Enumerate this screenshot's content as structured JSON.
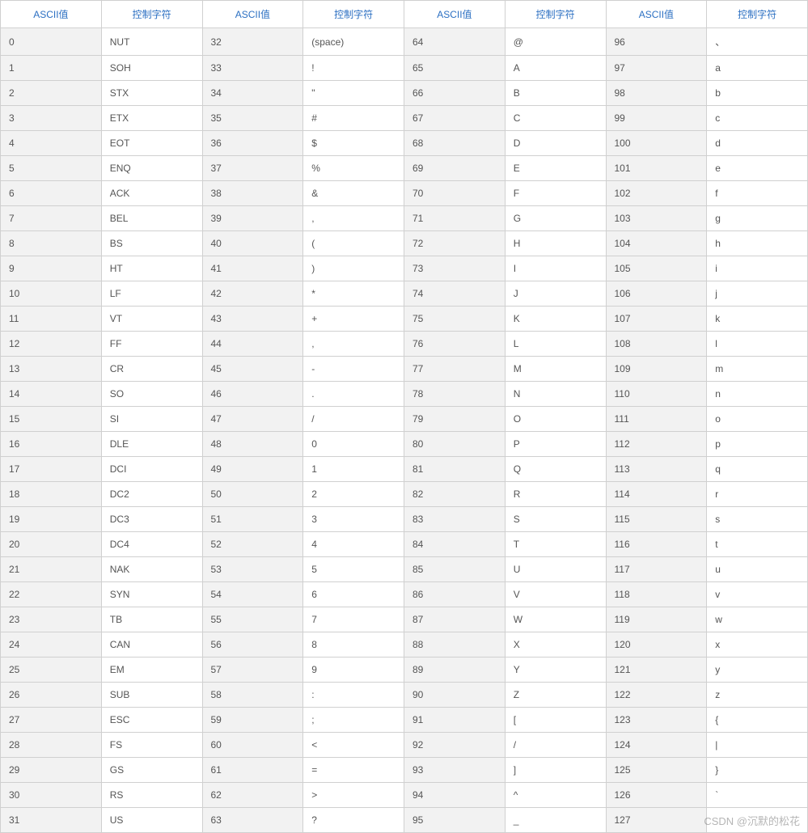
{
  "headers": {
    "ascii": "ASCII值",
    "char": "控制字符"
  },
  "columns": 4,
  "rows": [
    [
      {
        "v": "0",
        "c": "NUT"
      },
      {
        "v": "32",
        "c": "(space)"
      },
      {
        "v": "64",
        "c": "@"
      },
      {
        "v": "96",
        "c": "、"
      }
    ],
    [
      {
        "v": "1",
        "c": "SOH"
      },
      {
        "v": "33",
        "c": "!"
      },
      {
        "v": "65",
        "c": "A"
      },
      {
        "v": "97",
        "c": "a"
      }
    ],
    [
      {
        "v": "2",
        "c": "STX"
      },
      {
        "v": "34",
        "c": "\""
      },
      {
        "v": "66",
        "c": "B"
      },
      {
        "v": "98",
        "c": "b"
      }
    ],
    [
      {
        "v": "3",
        "c": "ETX"
      },
      {
        "v": "35",
        "c": "#"
      },
      {
        "v": "67",
        "c": "C"
      },
      {
        "v": "99",
        "c": "c"
      }
    ],
    [
      {
        "v": "4",
        "c": "EOT"
      },
      {
        "v": "36",
        "c": "$"
      },
      {
        "v": "68",
        "c": "D"
      },
      {
        "v": "100",
        "c": "d"
      }
    ],
    [
      {
        "v": "5",
        "c": "ENQ"
      },
      {
        "v": "37",
        "c": "%"
      },
      {
        "v": "69",
        "c": "E"
      },
      {
        "v": "101",
        "c": "e"
      }
    ],
    [
      {
        "v": "6",
        "c": "ACK"
      },
      {
        "v": "38",
        "c": "&"
      },
      {
        "v": "70",
        "c": "F"
      },
      {
        "v": "102",
        "c": "f"
      }
    ],
    [
      {
        "v": "7",
        "c": "BEL"
      },
      {
        "v": "39",
        "c": ","
      },
      {
        "v": "71",
        "c": "G"
      },
      {
        "v": "103",
        "c": "g"
      }
    ],
    [
      {
        "v": "8",
        "c": "BS"
      },
      {
        "v": "40",
        "c": "("
      },
      {
        "v": "72",
        "c": "H"
      },
      {
        "v": "104",
        "c": "h"
      }
    ],
    [
      {
        "v": "9",
        "c": "HT"
      },
      {
        "v": "41",
        "c": ")"
      },
      {
        "v": "73",
        "c": "I"
      },
      {
        "v": "105",
        "c": "i"
      }
    ],
    [
      {
        "v": "10",
        "c": "LF"
      },
      {
        "v": "42",
        "c": "*"
      },
      {
        "v": "74",
        "c": "J"
      },
      {
        "v": "106",
        "c": "j"
      }
    ],
    [
      {
        "v": "11",
        "c": "VT"
      },
      {
        "v": "43",
        "c": "+"
      },
      {
        "v": "75",
        "c": "K"
      },
      {
        "v": "107",
        "c": "k"
      }
    ],
    [
      {
        "v": "12",
        "c": "FF"
      },
      {
        "v": "44",
        "c": ","
      },
      {
        "v": "76",
        "c": "L"
      },
      {
        "v": "108",
        "c": "l"
      }
    ],
    [
      {
        "v": "13",
        "c": "CR"
      },
      {
        "v": "45",
        "c": "-"
      },
      {
        "v": "77",
        "c": "M"
      },
      {
        "v": "109",
        "c": "m"
      }
    ],
    [
      {
        "v": "14",
        "c": "SO"
      },
      {
        "v": "46",
        "c": "."
      },
      {
        "v": "78",
        "c": "N"
      },
      {
        "v": "110",
        "c": "n"
      }
    ],
    [
      {
        "v": "15",
        "c": "SI"
      },
      {
        "v": "47",
        "c": "/"
      },
      {
        "v": "79",
        "c": "O"
      },
      {
        "v": "111",
        "c": "o"
      }
    ],
    [
      {
        "v": "16",
        "c": "DLE"
      },
      {
        "v": "48",
        "c": "0"
      },
      {
        "v": "80",
        "c": "P"
      },
      {
        "v": "112",
        "c": "p"
      }
    ],
    [
      {
        "v": "17",
        "c": "DCI"
      },
      {
        "v": "49",
        "c": "1"
      },
      {
        "v": "81",
        "c": "Q"
      },
      {
        "v": "113",
        "c": "q"
      }
    ],
    [
      {
        "v": "18",
        "c": "DC2"
      },
      {
        "v": "50",
        "c": "2"
      },
      {
        "v": "82",
        "c": "R"
      },
      {
        "v": "114",
        "c": "r"
      }
    ],
    [
      {
        "v": "19",
        "c": "DC3"
      },
      {
        "v": "51",
        "c": "3"
      },
      {
        "v": "83",
        "c": "S"
      },
      {
        "v": "115",
        "c": "s"
      }
    ],
    [
      {
        "v": "20",
        "c": "DC4"
      },
      {
        "v": "52",
        "c": "4"
      },
      {
        "v": "84",
        "c": "T"
      },
      {
        "v": "116",
        "c": "t"
      }
    ],
    [
      {
        "v": "21",
        "c": "NAK"
      },
      {
        "v": "53",
        "c": "5"
      },
      {
        "v": "85",
        "c": "U"
      },
      {
        "v": "117",
        "c": "u"
      }
    ],
    [
      {
        "v": "22",
        "c": "SYN"
      },
      {
        "v": "54",
        "c": "6"
      },
      {
        "v": "86",
        "c": "V"
      },
      {
        "v": "118",
        "c": "v"
      }
    ],
    [
      {
        "v": "23",
        "c": "TB"
      },
      {
        "v": "55",
        "c": "7"
      },
      {
        "v": "87",
        "c": "W"
      },
      {
        "v": "119",
        "c": "w"
      }
    ],
    [
      {
        "v": "24",
        "c": "CAN"
      },
      {
        "v": "56",
        "c": "8"
      },
      {
        "v": "88",
        "c": "X"
      },
      {
        "v": "120",
        "c": "x"
      }
    ],
    [
      {
        "v": "25",
        "c": "EM"
      },
      {
        "v": "57",
        "c": "9"
      },
      {
        "v": "89",
        "c": "Y"
      },
      {
        "v": "121",
        "c": "y"
      }
    ],
    [
      {
        "v": "26",
        "c": "SUB"
      },
      {
        "v": "58",
        "c": ":"
      },
      {
        "v": "90",
        "c": "Z"
      },
      {
        "v": "122",
        "c": "z"
      }
    ],
    [
      {
        "v": "27",
        "c": "ESC"
      },
      {
        "v": "59",
        "c": ";"
      },
      {
        "v": "91",
        "c": "["
      },
      {
        "v": "123",
        "c": "{"
      }
    ],
    [
      {
        "v": "28",
        "c": "FS"
      },
      {
        "v": "60",
        "c": "<"
      },
      {
        "v": "92",
        "c": "/"
      },
      {
        "v": "124",
        "c": "|"
      }
    ],
    [
      {
        "v": "29",
        "c": "GS"
      },
      {
        "v": "61",
        "c": "="
      },
      {
        "v": "93",
        "c": "]"
      },
      {
        "v": "125",
        "c": "}"
      }
    ],
    [
      {
        "v": "30",
        "c": "RS"
      },
      {
        "v": "62",
        "c": ">"
      },
      {
        "v": "94",
        "c": "^"
      },
      {
        "v": "126",
        "c": "`"
      }
    ],
    [
      {
        "v": "31",
        "c": "US"
      },
      {
        "v": "63",
        "c": "?"
      },
      {
        "v": "95",
        "c": "_"
      },
      {
        "v": "127",
        "c": ""
      }
    ]
  ],
  "watermark": "CSDN @沉默的松花"
}
